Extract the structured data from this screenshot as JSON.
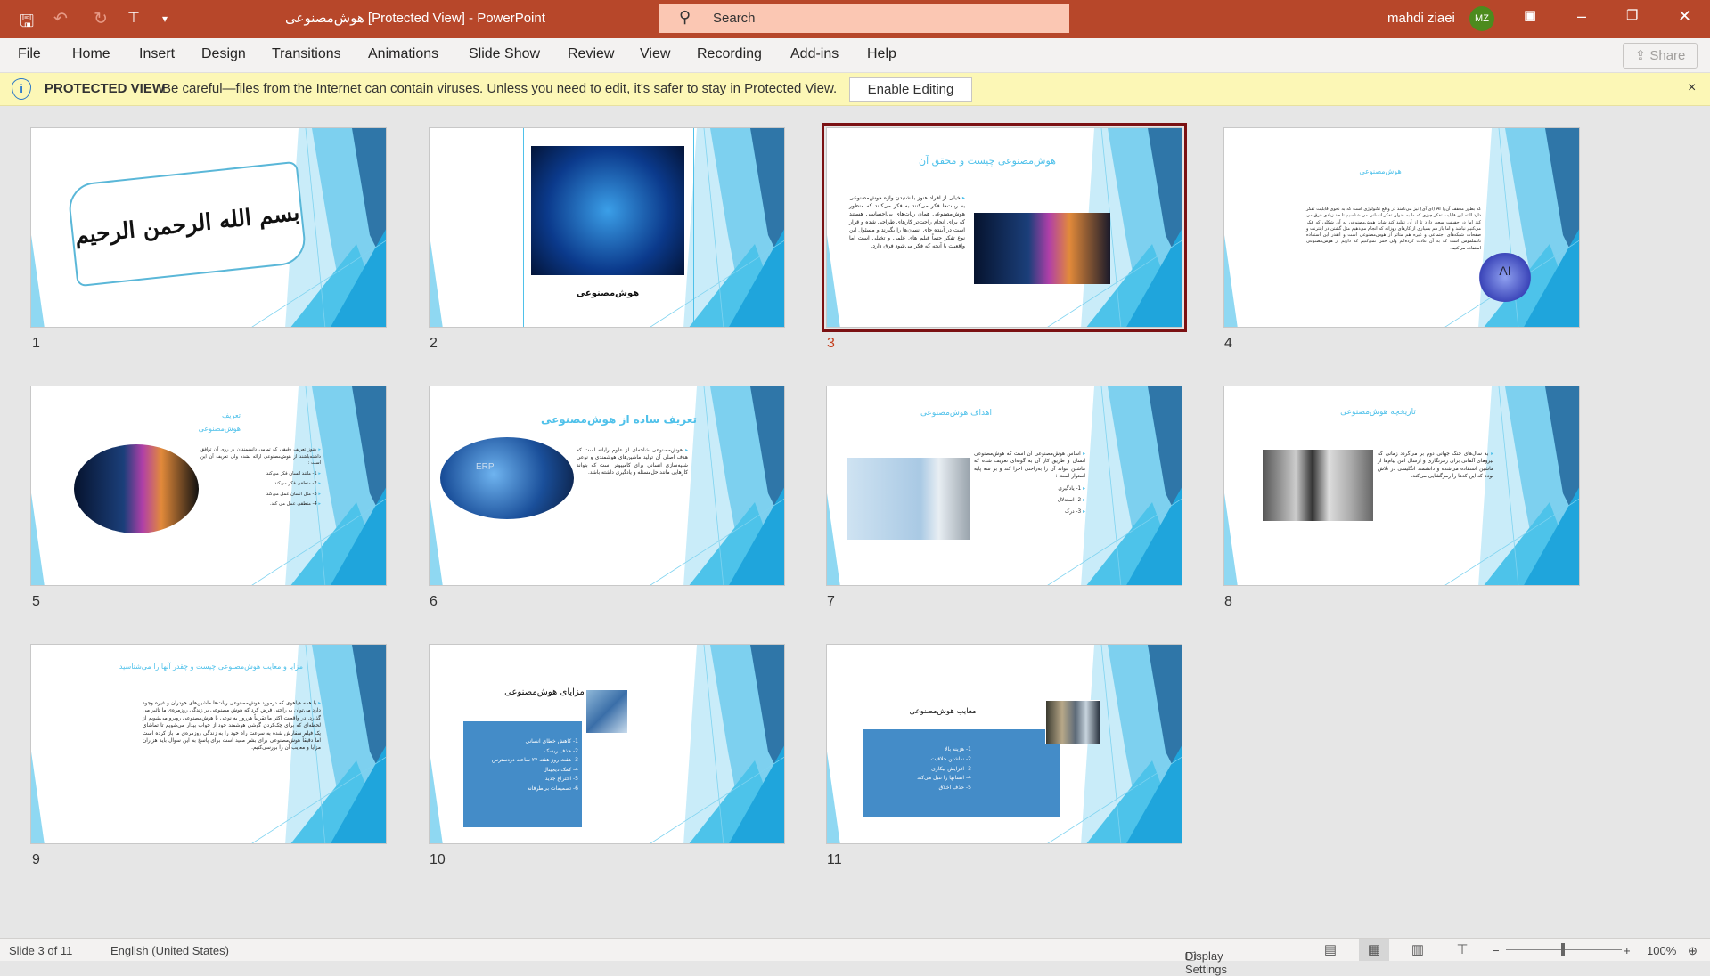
{
  "titlebar": {
    "document_title": "هوش‌مصنوعی [Protected View]  -  PowerPoint",
    "search_placeholder": "Search",
    "user_name": "mahdi ziaei",
    "user_initials": "MZ",
    "accent": "#b7472a"
  },
  "ribbon": {
    "tabs": [
      "File",
      "Home",
      "Insert",
      "Design",
      "Transitions",
      "Animations",
      "Slide Show",
      "Review",
      "View",
      "Recording",
      "Add-ins",
      "Help"
    ],
    "share": "Share"
  },
  "protected_view": {
    "label": "PROTECTED VIEW",
    "message": "Be careful—files from the Internet can contain viruses. Unless you need to edit, it's safer to stay in Protected View.",
    "enable_button": "Enable Editing",
    "close": "×"
  },
  "slides": [
    {
      "number": "1",
      "calligraphy": "بسم الله الرحمن الرحیم"
    },
    {
      "number": "2",
      "caption": "هوش‌مصنوعی"
    },
    {
      "number": "3",
      "title": "هوش‌مصنوعی چیست و محقق آن",
      "body": "خیلی از افراد هنوز با شنیدن واژه هوش‌مصنوعی به ربات‌ها فکر می‌کنند به فکر می‌کنند که منظور هوش‌مصنوعی همان ربات‌های بی‌احساسی هستند که برای انجام راحت‌تر کارهای طراحی شده و قرار است در آینده جای انسان‌ها را بگیرند و مسئول این نوع تفکر حتماً فیلم های علمی و تخیلی است اما واقعیت با آنچه که فکر می‌شود فرق دارد."
    },
    {
      "number": "4",
      "title": "هوش‌مصنوعی",
      "body": "که بطور مخفف آن‌را AI (ای آی) نیز می‌نامند در واقع تکنولوژی است که به نحوی قابلیت تفکر دارد البته این قابلیت تفکر چیزی که ما به عنوان تفکر انسانی می شناسیم تا حد زیادی فرق می کند اما در حقیقت سعی دارد تا از آن تقلید کند شاید هوش‌مصنوعی به آن شکلی که فکر می‌کنیم نباشد و اما باز هم بسیاری از کارهای روزانه که انجام می‌دهیم مثل گشتن در اینترنت و صفحات شبکه‌های اجتماعی و غیره هم متاثر از هوش‌مصنوعی است و آنقدر این استفاده نامملموس است که به آن عادت کرده‌ایم ولی حس نمی‌کنیم که داریم از هوش‌مصنوعی استفاده می‌کنیم.",
      "image_label": "AI"
    },
    {
      "number": "5",
      "title": "تعریف",
      "title2": "هوش‌مصنوعی",
      "body": "هنوز تعریف دقیقی که تمامی دانشمندان بر روی آن توافق داشته‌باشند از هوش‌مصنوعی ارائه نشده ولی تعریف آن این است :",
      "bullets": [
        "1- مانند انسان فکر می‌کند",
        "2- منطقی فکر می‌کند",
        "3- مثل انسان عمل می‌کند",
        "4- منطقی عمل می کند."
      ]
    },
    {
      "number": "6",
      "title": "تعریف ساده از هوش‌مصنوعی",
      "body": "هوش‌مصنوعی شاخه‌ای از علوم رایانه است که هدف اصلی آن تولید ماشین‌های هوشمندی و نوعی شبیه‌سازی انسانی برای کامپیوتر است که بتواند کارهایی مانند حل‌مسئله و یادگیری داشته باشد.",
      "image_label": "ERP"
    },
    {
      "number": "7",
      "title": "اهداف هوش‌مصنوعی",
      "body": "اساس هوش‌مصنوعی آن است که هوش‌مصنوعی انسان و طریق کار آن به گونه‌ای تعریف شده که ماشین بتواند آن را به‌راحتی اجرا کند و بر سه پایه استوار است :",
      "bullets": [
        "1- یادگیری",
        "2- استدلال",
        "3- درک"
      ]
    },
    {
      "number": "8",
      "title": "تاریخچه هوش‌مصنوعی",
      "body": "به سال‌های جنگ جهانی دوم بر می‌گردد زمانی که نیروهای آلمانی برای رمزنگاری و ارسال امن پیام‌ها از ماشین استفاده می‌شده و دانشمند انگلیسی در تلاش بوده که این کدها را رمزگشایی می‌کند."
    },
    {
      "number": "9",
      "title": "مزایا و معایب هوش‌مصنوعی چیست و چقدر آنها را می‌شناسید",
      "body": "با همه هیاهوی که درمورد هوش‌مصنوعی ربات‌ها ماشین‌های خودران و غیره وجود دارد می‌توان به راحتی فرض کرد که هوش مصنوعی بر زندگی روزمره‌ی ما تاثیر می گذارد. در واقعیت اکثر ما تقریباً هرروز به نوعی با هوش‌مصنوعی روبرو می‌شویم از لحظه‌ای که برای چک‌کردن گوشی هوشمند خود از خواب بیدار می‌شویم تا تماشای یک فیلم سفارش شده به سرعت راه خود را به زندگی روزمره‌ی ما باز کرده است اما دقیقاً هوش‌مصنوعی برای بشر مفید است برای پاسخ به این سوال باید هزاران مزایا و معایب آن را بررسی‌کنیم."
    },
    {
      "number": "10",
      "title": "مزایای هوش‌مصنوعی",
      "bullets": [
        "1- کاهش خطای انسانی",
        "2- حذف ریسک",
        "3- هفت روز هفته ۲۴ ساعته دردسترس",
        "4- کمک دیجیتال",
        "5- اختراع جدید",
        "6- تصمیمات بی‌طرفانه"
      ]
    },
    {
      "number": "11",
      "title": "معایب هوش‌مصنوعی",
      "bullets": [
        "1- هزینه بالا",
        "2- نداشتن خلاقیت",
        "3- افزایش بیکاری",
        "4- انسانها را تنبل می‌کند",
        "5- حذف اخلاق"
      ]
    }
  ],
  "selected_slide": "3",
  "status": {
    "slide_info": "Slide 3 of 11",
    "language": "English (United States)",
    "display_settings": "Display Settings",
    "zoom": "100%",
    "zoom_level_percent": 100
  },
  "colors": {
    "slide_title": "#4fc1ea",
    "selection": "#7b1113",
    "box_blue": "#448cc8"
  }
}
